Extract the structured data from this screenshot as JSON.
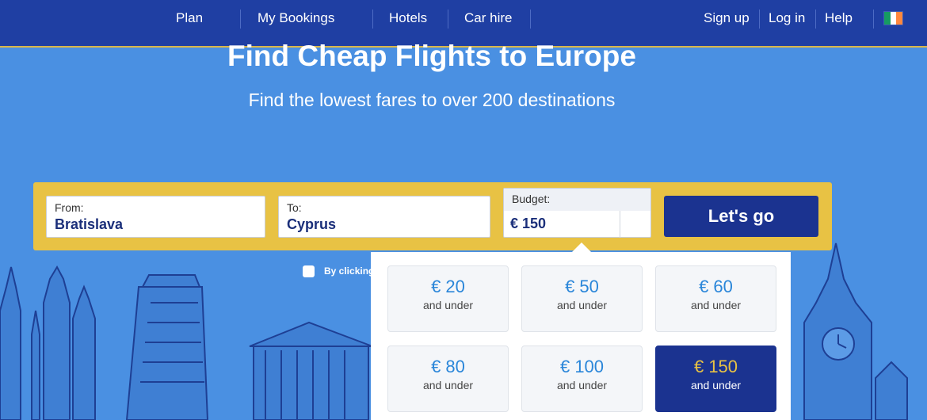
{
  "nav": {
    "left": [
      "Plan",
      "My Bookings",
      "Hotels",
      "Car hire"
    ],
    "right": [
      "Sign up",
      "Log in",
      "Help"
    ],
    "flag_icon": "ireland-flag-icon"
  },
  "hero": {
    "title": "Find Cheap Flights to Europe",
    "subtitle": "Find the lowest fares to over 200 destinations"
  },
  "search": {
    "from_label": "From:",
    "from_value": "Bratislava",
    "to_label": "To:",
    "to_value": "Cyprus",
    "budget_label": "Budget:",
    "budget_value": "€ 150",
    "go_label": "Let's go",
    "checkbox_label": "By clicking"
  },
  "budget_options": [
    {
      "price": "€ 20",
      "note": "and under",
      "selected": false
    },
    {
      "price": "€ 50",
      "note": "and under",
      "selected": false
    },
    {
      "price": "€ 60",
      "note": "and under",
      "selected": false
    },
    {
      "price": "€ 80",
      "note": "and under",
      "selected": false
    },
    {
      "price": "€ 100",
      "note": "and under",
      "selected": false
    },
    {
      "price": "€ 150",
      "note": "and under",
      "selected": true
    }
  ],
  "colors": {
    "nav_bg": "#1f3fa3",
    "hero_bg": "#4a90e2",
    "accent_yellow": "#e8c244",
    "button_navy": "#1b3390",
    "price_blue": "#2a86d9"
  }
}
